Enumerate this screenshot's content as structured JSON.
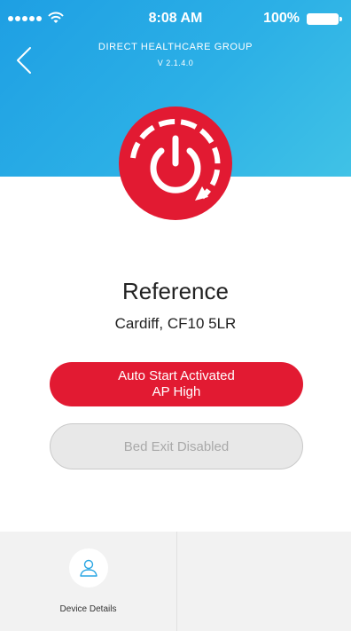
{
  "status_bar": {
    "time": "8:08 AM",
    "battery_percent": "100%",
    "signal_dots": 5
  },
  "header": {
    "org_title": "DIRECT HEALTHCARE GROUP",
    "version": "V 2.1.4.0",
    "back_icon": "chevron-left-icon"
  },
  "power": {
    "icon": "power-icon",
    "color": "#e21a32"
  },
  "device": {
    "reference": "Reference",
    "location": "Cardiff, CF10 5LR"
  },
  "buttons": {
    "auto_start_line1": "Auto Start Activated",
    "auto_start_line2": "AP High",
    "bed_exit": "Bed Exit Disabled"
  },
  "bottom_nav": {
    "device_details_label": "Device Details",
    "device_details_icon": "user-icon"
  },
  "colors": {
    "header_gradient_start": "#1e9fe3",
    "header_gradient_end": "#40c2e6",
    "accent_red": "#e21a32",
    "disabled_gray": "#e8e8e8"
  }
}
